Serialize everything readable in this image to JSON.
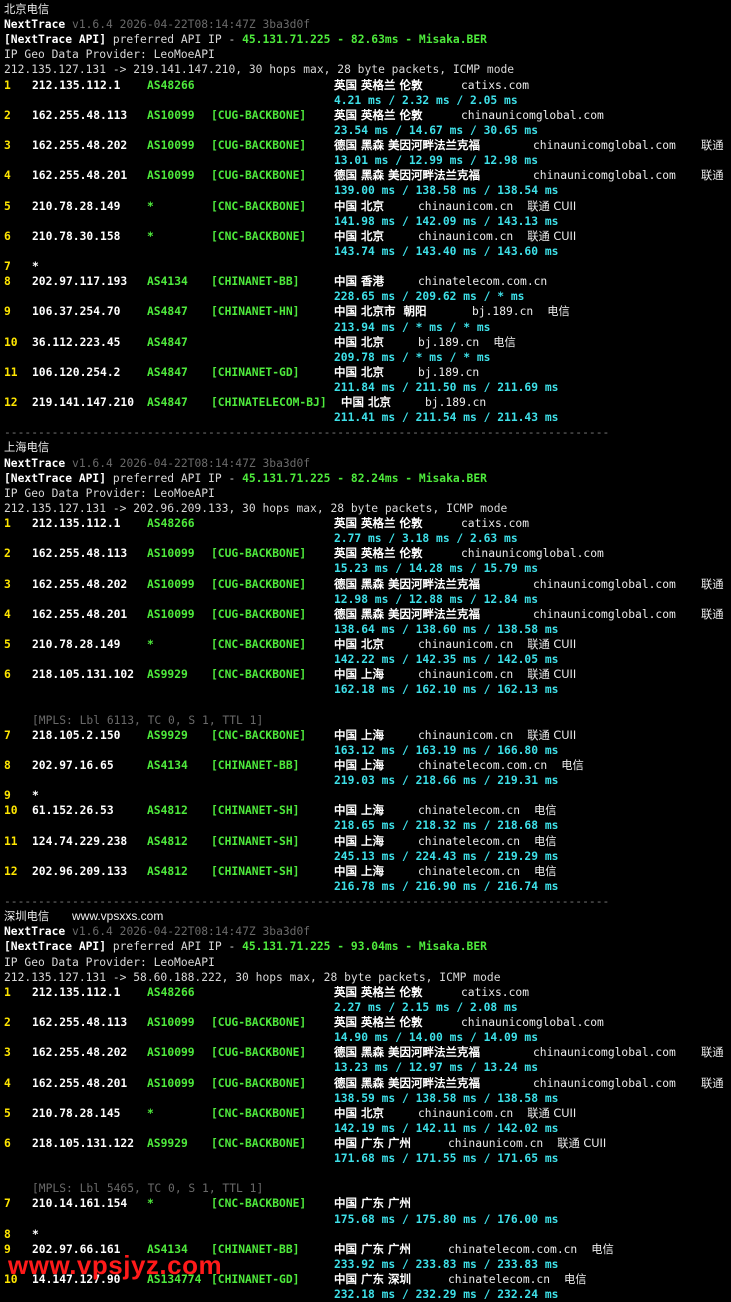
{
  "sections": [
    {
      "title": "北京电信",
      "site_label": "",
      "header": {
        "app": "NextTrace",
        "version": "v1.6.4 2026-04-22T08:14:47Z 3ba3d0f"
      },
      "api_line": {
        "tag": "[NextTrace API]",
        "text": " preferred API IP - ",
        "ip": "45.131.71.225",
        "dash1": " - ",
        "latency": "82.63ms",
        "dash2": " - ",
        "node": "Misaka.BER"
      },
      "geo_provider": "IP Geo Data Provider: LeoMoeAPI",
      "route": "212.135.127.131 -> 219.141.147.210, 30 hops max, 28 byte packets, ICMP mode",
      "hops": [
        {
          "n": "1",
          "ip": "212.135.112.1",
          "as": "AS48266",
          "tag": "",
          "geo": "英国 英格兰 伦敦",
          "domain": "catixs.com",
          "isp": "",
          "times": "4.21 ms / 2.32 ms / 2.05 ms"
        },
        {
          "n": "2",
          "ip": "162.255.48.113",
          "as": "AS10099",
          "tag": "[CUG-BACKBONE]",
          "geo": "英国 英格兰 伦敦",
          "domain": "chinaunicomglobal.com",
          "isp": "",
          "times": "23.54 ms / 14.67 ms / 30.65 ms"
        },
        {
          "n": "3",
          "ip": "162.255.48.202",
          "as": "AS10099",
          "tag": "[CUG-BACKBONE]",
          "geo": "德国 黑森 美因河畔法兰克福",
          "domain": "chinaunicomglobal.com",
          "isp": "联通",
          "times": "13.01 ms / 12.99 ms / 12.98 ms"
        },
        {
          "n": "4",
          "ip": "162.255.48.201",
          "as": "AS10099",
          "tag": "[CUG-BACKBONE]",
          "geo": "德国 黑森 美因河畔法兰克福",
          "domain": "chinaunicomglobal.com",
          "isp": "联通",
          "times": "139.00 ms / 138.58 ms / 138.54 ms"
        },
        {
          "n": "5",
          "ip": "210.78.28.149",
          "as": "*",
          "tag": "[CNC-BACKBONE]",
          "geo": "中国 北京",
          "domain": "chinaunicom.cn",
          "isp": "联通 CUII",
          "times": "141.98 ms / 142.09 ms / 143.13 ms"
        },
        {
          "n": "6",
          "ip": "210.78.30.158",
          "as": "*",
          "tag": "[CNC-BACKBONE]",
          "geo": "中国 北京",
          "domain": "chinaunicom.cn",
          "isp": "联通 CUII",
          "times": "143.74 ms / 143.40 ms / 143.60 ms"
        },
        {
          "n": "7",
          "ip": "*",
          "as": "",
          "tag": "",
          "geo": "",
          "domain": "",
          "isp": "",
          "times": ""
        },
        {
          "n": "8",
          "ip": "202.97.117.193",
          "as": "AS4134",
          "tag": "[CHINANET-BB]",
          "geo": "中国 香港",
          "domain": "chinatelecom.com.cn",
          "isp": "",
          "times": "228.65 ms / 209.62 ms / * ms"
        },
        {
          "n": "9",
          "ip": "106.37.254.70",
          "as": "AS4847",
          "tag": "[CHINANET-HN]",
          "geo": "中国 北京市  朝阳",
          "domain": "bj.189.cn",
          "isp": "电信",
          "times": "213.94 ms / * ms / * ms"
        },
        {
          "n": "10",
          "ip": "36.112.223.45",
          "as": "AS4847",
          "tag": "",
          "geo": "中国 北京",
          "domain": "bj.189.cn",
          "isp": "电信",
          "times": "209.78 ms / * ms / * ms"
        },
        {
          "n": "11",
          "ip": "106.120.254.2",
          "as": "AS4847",
          "tag": "[CHINANET-GD]",
          "geo": "中国 北京",
          "domain": "bj.189.cn",
          "isp": "",
          "times": "211.84 ms / 211.50 ms / 211.69 ms"
        },
        {
          "n": "12",
          "ip": "219.141.147.210",
          "as": "AS4847",
          "tag": "[CHINATELECOM-BJ]",
          "geo": "中国 北京",
          "domain": "bj.189.cn",
          "isp": "",
          "times": "211.41 ms / 211.54 ms / 211.43 ms"
        }
      ]
    },
    {
      "title": "上海电信",
      "site_label": "",
      "header": {
        "app": "NextTrace",
        "version": "v1.6.4 2026-04-22T08:14:47Z 3ba3d0f"
      },
      "api_line": {
        "tag": "[NextTrace API]",
        "text": " preferred API IP - ",
        "ip": "45.131.71.225",
        "dash1": " - ",
        "latency": "82.24ms",
        "dash2": " - ",
        "node": "Misaka.BER"
      },
      "geo_provider": "IP Geo Data Provider: LeoMoeAPI",
      "route": "212.135.127.131 -> 202.96.209.133, 30 hops max, 28 byte packets, ICMP mode",
      "hops": [
        {
          "n": "1",
          "ip": "212.135.112.1",
          "as": "AS48266",
          "tag": "",
          "geo": "英国 英格兰 伦敦",
          "domain": "catixs.com",
          "isp": "",
          "times": "2.77 ms / 3.18 ms / 2.63 ms"
        },
        {
          "n": "2",
          "ip": "162.255.48.113",
          "as": "AS10099",
          "tag": "[CUG-BACKBONE]",
          "geo": "英国 英格兰 伦敦",
          "domain": "chinaunicomglobal.com",
          "isp": "",
          "times": "15.23 ms / 14.28 ms / 15.79 ms"
        },
        {
          "n": "3",
          "ip": "162.255.48.202",
          "as": "AS10099",
          "tag": "[CUG-BACKBONE]",
          "geo": "德国 黑森 美因河畔法兰克福",
          "domain": "chinaunicomglobal.com",
          "isp": "联通",
          "times": "12.98 ms / 12.88 ms / 12.84 ms"
        },
        {
          "n": "4",
          "ip": "162.255.48.201",
          "as": "AS10099",
          "tag": "[CUG-BACKBONE]",
          "geo": "德国 黑森 美因河畔法兰克福",
          "domain": "chinaunicomglobal.com",
          "isp": "联通",
          "times": "138.64 ms / 138.60 ms / 138.58 ms"
        },
        {
          "n": "5",
          "ip": "210.78.28.149",
          "as": "*",
          "tag": "[CNC-BACKBONE]",
          "geo": "中国 北京",
          "domain": "chinaunicom.cn",
          "isp": "联通 CUII",
          "times": "142.22 ms / 142.35 ms / 142.05 ms"
        },
        {
          "n": "6",
          "ip": "218.105.131.102",
          "as": "AS9929",
          "tag": "[CNC-BACKBONE]",
          "geo": "中国 上海",
          "domain": "chinaunicom.cn",
          "isp": "联通 CUII",
          "times": "162.18 ms / 162.10 ms / 162.13 ms",
          "mpls": "[MPLS: Lbl 6113, TC 0, S 1, TTL 1]"
        },
        {
          "n": "7",
          "ip": "218.105.2.150",
          "as": "AS9929",
          "tag": "[CNC-BACKBONE]",
          "geo": "中国 上海",
          "domain": "chinaunicom.cn",
          "isp": "联通 CUII",
          "times": "163.12 ms / 163.19 ms / 166.80 ms"
        },
        {
          "n": "8",
          "ip": "202.97.16.65",
          "as": "AS4134",
          "tag": "[CHINANET-BB]",
          "geo": "中国 上海",
          "domain": "chinatelecom.com.cn",
          "isp": "电信",
          "times": "219.03 ms / 218.66 ms / 219.31 ms"
        },
        {
          "n": "9",
          "ip": "*",
          "as": "",
          "tag": "",
          "geo": "",
          "domain": "",
          "isp": "",
          "times": ""
        },
        {
          "n": "10",
          "ip": "61.152.26.53",
          "as": "AS4812",
          "tag": "[CHINANET-SH]",
          "geo": "中国 上海",
          "domain": "chinatelecom.cn",
          "isp": "电信",
          "times": "218.65 ms / 218.32 ms / 218.68 ms"
        },
        {
          "n": "11",
          "ip": "124.74.229.238",
          "as": "AS4812",
          "tag": "[CHINANET-SH]",
          "geo": "中国 上海",
          "domain": "chinatelecom.cn",
          "isp": "电信",
          "times": "245.13 ms / 224.43 ms / 219.29 ms"
        },
        {
          "n": "12",
          "ip": "202.96.209.133",
          "as": "AS4812",
          "tag": "[CHINANET-SH]",
          "geo": "中国 上海",
          "domain": "chinatelecom.cn",
          "isp": "电信",
          "times": "216.78 ms / 216.90 ms / 216.74 ms"
        }
      ]
    },
    {
      "title": "深圳电信",
      "site_label": "www.vpsxxs.com",
      "header": {
        "app": "NextTrace",
        "version": "v1.6.4 2026-04-22T08:14:47Z 3ba3d0f"
      },
      "api_line": {
        "tag": "[NextTrace API]",
        "text": " preferred API IP - ",
        "ip": "45.131.71.225",
        "dash1": " - ",
        "latency": "93.04ms",
        "dash2": " - ",
        "node": "Misaka.BER"
      },
      "geo_provider": "IP Geo Data Provider: LeoMoeAPI",
      "route": "212.135.127.131 -> 58.60.188.222, 30 hops max, 28 byte packets, ICMP mode",
      "hops": [
        {
          "n": "1",
          "ip": "212.135.112.1",
          "as": "AS48266",
          "tag": "",
          "geo": "英国 英格兰 伦敦",
          "domain": "catixs.com",
          "isp": "",
          "times": "2.27 ms / 2.15 ms / 2.08 ms"
        },
        {
          "n": "2",
          "ip": "162.255.48.113",
          "as": "AS10099",
          "tag": "[CUG-BACKBONE]",
          "geo": "英国 英格兰 伦敦",
          "domain": "chinaunicomglobal.com",
          "isp": "",
          "times": "14.90 ms / 14.00 ms / 14.09 ms"
        },
        {
          "n": "3",
          "ip": "162.255.48.202",
          "as": "AS10099",
          "tag": "[CUG-BACKBONE]",
          "geo": "德国 黑森 美因河畔法兰克福",
          "domain": "chinaunicomglobal.com",
          "isp": "联通",
          "times": "13.23 ms / 12.97 ms / 13.24 ms"
        },
        {
          "n": "4",
          "ip": "162.255.48.201",
          "as": "AS10099",
          "tag": "[CUG-BACKBONE]",
          "geo": "德国 黑森 美因河畔法兰克福",
          "domain": "chinaunicomglobal.com",
          "isp": "联通",
          "times": "138.59 ms / 138.58 ms / 138.58 ms"
        },
        {
          "n": "5",
          "ip": "210.78.28.145",
          "as": "*",
          "tag": "[CNC-BACKBONE]",
          "geo": "中国 北京",
          "domain": "chinaunicom.cn",
          "isp": "联通 CUII",
          "times": "142.19 ms / 142.11 ms / 142.02 ms"
        },
        {
          "n": "6",
          "ip": "218.105.131.122",
          "as": "AS9929",
          "tag": "[CNC-BACKBONE]",
          "geo": "中国 广东 广州",
          "domain": "chinaunicom.cn",
          "isp": "联通 CUII",
          "times": "171.68 ms / 171.55 ms / 171.65 ms",
          "mpls": "[MPLS: Lbl 5465, TC 0, S 1, TTL 1]"
        },
        {
          "n": "7",
          "ip": "210.14.161.154",
          "as": "*",
          "tag": "[CNC-BACKBONE]",
          "geo": "中国 广东 广州",
          "domain": "",
          "isp": "",
          "times": "175.68 ms / 175.80 ms / 176.00 ms"
        },
        {
          "n": "8",
          "ip": "*",
          "as": "",
          "tag": "",
          "geo": "",
          "domain": "",
          "isp": "",
          "times": ""
        },
        {
          "n": "9",
          "ip": "202.97.66.161",
          "as": "AS4134",
          "tag": "[CHINANET-BB]",
          "geo": "中国 广东 广州",
          "domain": "chinatelecom.com.cn",
          "isp": "电信",
          "times": "233.92 ms / 233.83 ms / 233.83 ms"
        },
        {
          "n": "10",
          "ip": "14.147.127.90",
          "as": "AS134774",
          "tag": "[CHINANET-GD]",
          "geo": "中国 广东 深圳",
          "domain": "chinatelecom.cn",
          "isp": "电信",
          "times": "232.18 ms / 232.29 ms / 232.24 ms"
        }
      ]
    }
  ],
  "separator": "-----------------------------------------------------------------------------------------",
  "watermark": "www.vpsjyz.com",
  "colors": {
    "bg": "#000000",
    "cyan": "#3ee0e8",
    "yellow": "#ffe600",
    "green": "#4eea3c",
    "ip_yellow": "#d6ff5a"
  }
}
